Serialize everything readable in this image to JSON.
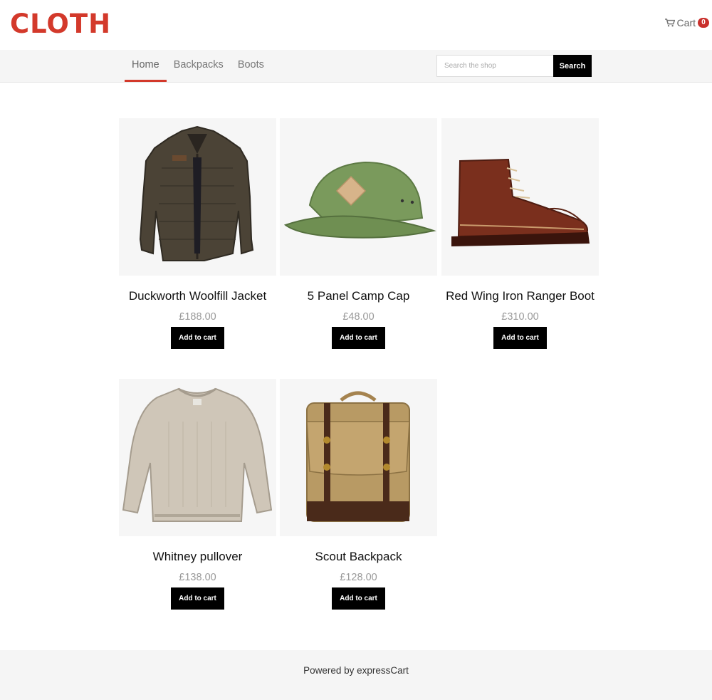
{
  "header": {
    "logo": "CLOTH",
    "cart_label": "Cart",
    "cart_count": "0",
    "cart_icon": "shopping-cart-icon"
  },
  "nav": {
    "items": [
      {
        "label": "Home",
        "active": true
      },
      {
        "label": "Backpacks",
        "active": false
      },
      {
        "label": "Boots",
        "active": false
      }
    ],
    "search_placeholder": "Search the shop",
    "search_value": "",
    "search_button": "Search"
  },
  "products": [
    {
      "title": "Duckworth Woolfill Jacket",
      "price": "£188.00",
      "button": "Add to cart",
      "image": "jacket-image"
    },
    {
      "title": "5 Panel Camp Cap",
      "price": "£48.00",
      "button": "Add to cart",
      "image": "cap-image"
    },
    {
      "title": "Red Wing Iron Ranger Boot",
      "price": "£310.00",
      "button": "Add to cart",
      "image": "boot-image"
    },
    {
      "title": "Whitney pullover",
      "price": "£138.00",
      "button": "Add to cart",
      "image": "pullover-image"
    },
    {
      "title": "Scout Backpack",
      "price": "£128.00",
      "button": "Add to cart",
      "image": "backpack-image"
    }
  ],
  "footer": {
    "text": "Powered by expressCart"
  },
  "colors": {
    "brand": "#d3392b",
    "badge": "#c9302c",
    "button": "#000000",
    "price": "#9a9a9a",
    "bar_bg": "#f5f5f5"
  }
}
